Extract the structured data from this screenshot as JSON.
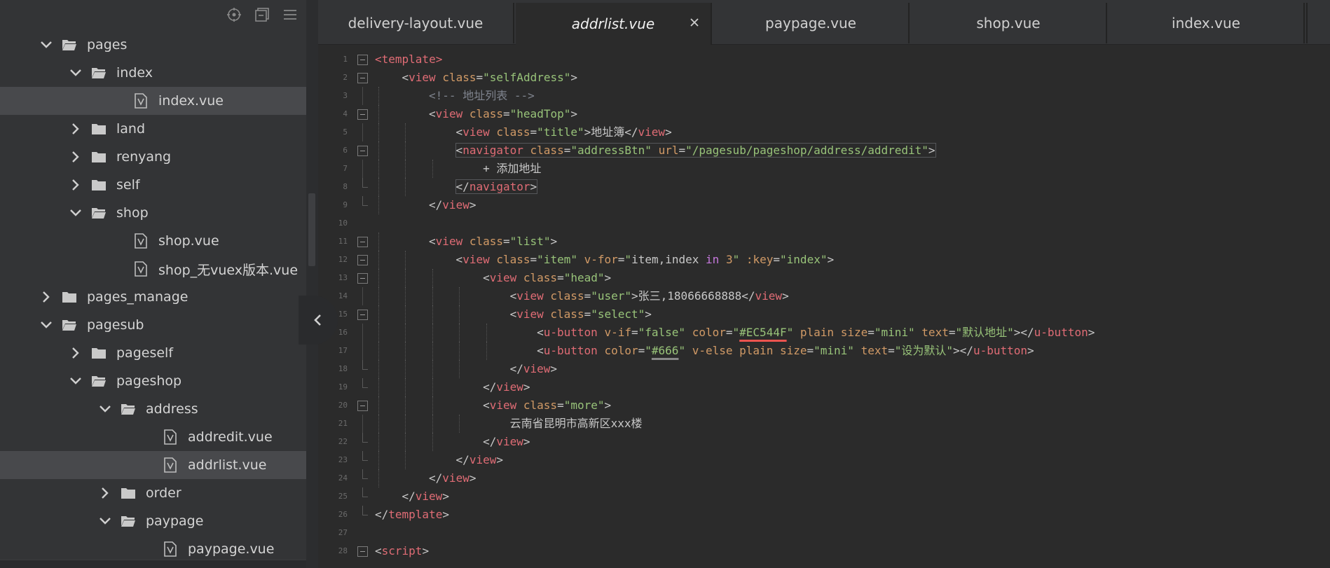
{
  "sidebar": {
    "toolbar": [
      {
        "icon": "locate-icon"
      },
      {
        "icon": "collapse-all-icon"
      },
      {
        "icon": "menu-icon"
      }
    ],
    "tree": [
      {
        "label": "pages",
        "type": "folder",
        "expanded": true,
        "depth": 1
      },
      {
        "label": "index",
        "type": "folder",
        "expanded": true,
        "depth": 2
      },
      {
        "label": "index.vue",
        "type": "file",
        "depth": 3,
        "selected": true
      },
      {
        "label": "land",
        "type": "folder",
        "expanded": false,
        "depth": 2
      },
      {
        "label": "renyang",
        "type": "folder",
        "expanded": false,
        "depth": 2
      },
      {
        "label": "self",
        "type": "folder",
        "expanded": false,
        "depth": 2
      },
      {
        "label": "shop",
        "type": "folder",
        "expanded": true,
        "depth": 2
      },
      {
        "label": "shop.vue",
        "type": "file",
        "depth": 3
      },
      {
        "label": "shop_无vuex版本.vue",
        "type": "file",
        "depth": 3
      },
      {
        "label": "pages_manage",
        "type": "folder",
        "expanded": false,
        "depth": 1
      },
      {
        "label": "pagesub",
        "type": "folder",
        "expanded": true,
        "depth": 1
      },
      {
        "label": "pageself",
        "type": "folder",
        "expanded": false,
        "depth": 2
      },
      {
        "label": "pageshop",
        "type": "folder",
        "expanded": true,
        "depth": 2
      },
      {
        "label": "address",
        "type": "folder",
        "expanded": true,
        "depth": 3
      },
      {
        "label": "addredit.vue",
        "type": "file",
        "depth": 4
      },
      {
        "label": "addrlist.vue",
        "type": "file",
        "depth": 4,
        "selected": true
      },
      {
        "label": "order",
        "type": "folder",
        "expanded": false,
        "depth": 3
      },
      {
        "label": "paypage",
        "type": "folder",
        "expanded": true,
        "depth": 3
      },
      {
        "label": "paypage.vue",
        "type": "file",
        "depth": 4
      }
    ]
  },
  "tabs": [
    {
      "label": "delivery-layout.vue",
      "active": false
    },
    {
      "label": "addrlist.vue",
      "active": true,
      "close": "×"
    },
    {
      "label": "paypage.vue",
      "active": false
    },
    {
      "label": "shop.vue",
      "active": false
    },
    {
      "label": "index.vue",
      "active": false
    }
  ],
  "editor": {
    "lines": [
      {
        "n": "1",
        "fold": "open",
        "indent": 0,
        "tokens": [
          [
            "tag",
            "<template"
          ],
          [
            "tag",
            ">"
          ]
        ]
      },
      {
        "n": "2",
        "fold": "open",
        "indent": 1,
        "tokens": [
          [
            "br",
            "<"
          ],
          [
            "tag",
            "view"
          ],
          [
            "br",
            " "
          ],
          [
            "attr",
            "class"
          ],
          [
            "br",
            "="
          ],
          [
            "str",
            "\"selfAddress\""
          ],
          [
            "br",
            ">"
          ]
        ]
      },
      {
        "n": "3",
        "fold": "",
        "indent": 2,
        "tokens": [
          [
            "cmt",
            "<!-- 地址列表 -->"
          ]
        ]
      },
      {
        "n": "4",
        "fold": "open",
        "indent": 2,
        "tokens": [
          [
            "br",
            "<"
          ],
          [
            "tag",
            "view"
          ],
          [
            "br",
            " "
          ],
          [
            "attr",
            "class"
          ],
          [
            "br",
            "="
          ],
          [
            "str",
            "\"headTop\""
          ],
          [
            "br",
            ">"
          ]
        ]
      },
      {
        "n": "5",
        "fold": "",
        "indent": 3,
        "tokens": [
          [
            "br",
            "<"
          ],
          [
            "tag",
            "view"
          ],
          [
            "br",
            " "
          ],
          [
            "attr",
            "class"
          ],
          [
            "br",
            "="
          ],
          [
            "str",
            "\"title\""
          ],
          [
            "br",
            ">"
          ],
          [
            "txt",
            "地址簿"
          ],
          [
            "br",
            "</"
          ],
          [
            "tag",
            "view"
          ],
          [
            "br",
            ">"
          ]
        ]
      },
      {
        "n": "6",
        "fold": "open",
        "indent": 3,
        "box": true,
        "tokens": [
          [
            "br",
            "<"
          ],
          [
            "tag",
            "navigator"
          ],
          [
            "br",
            " "
          ],
          [
            "attr",
            "class"
          ],
          [
            "br",
            "="
          ],
          [
            "str",
            "\"addressBtn\""
          ],
          [
            "br",
            " "
          ],
          [
            "attr",
            "url"
          ],
          [
            "br",
            "="
          ],
          [
            "str",
            "\"/pagesub/pageshop/address/addredit\""
          ],
          [
            "br",
            ">"
          ]
        ]
      },
      {
        "n": "7",
        "fold": "",
        "indent": 4,
        "tokens": [
          [
            "txt",
            "+ 添加地址"
          ]
        ]
      },
      {
        "n": "8",
        "fold": "end",
        "indent": 3,
        "box": true,
        "tokens": [
          [
            "br",
            "</"
          ],
          [
            "tag",
            "navigator"
          ],
          [
            "br",
            ">"
          ]
        ]
      },
      {
        "n": "9",
        "fold": "end",
        "indent": 2,
        "tokens": [
          [
            "br",
            "</"
          ],
          [
            "tag",
            "view"
          ],
          [
            "br",
            ">"
          ]
        ]
      },
      {
        "n": "10",
        "fold": "",
        "indent": 0,
        "tokens": []
      },
      {
        "n": "11",
        "fold": "open",
        "indent": 2,
        "tokens": [
          [
            "br",
            "<"
          ],
          [
            "tag",
            "view"
          ],
          [
            "br",
            " "
          ],
          [
            "attr",
            "class"
          ],
          [
            "br",
            "="
          ],
          [
            "str",
            "\"list\""
          ],
          [
            "br",
            ">"
          ]
        ]
      },
      {
        "n": "12",
        "fold": "open",
        "indent": 3,
        "tokens": [
          [
            "br",
            "<"
          ],
          [
            "tag",
            "view"
          ],
          [
            "br",
            " "
          ],
          [
            "attr",
            "class"
          ],
          [
            "br",
            "="
          ],
          [
            "str",
            "\"item\""
          ],
          [
            "br",
            " "
          ],
          [
            "attr",
            "v-for"
          ],
          [
            "br",
            "="
          ],
          [
            "str",
            "\""
          ],
          [
            "txt",
            "item,index "
          ],
          [
            "kw",
            "in"
          ],
          [
            "txt",
            " "
          ],
          [
            "attr",
            "3"
          ],
          [
            "str",
            "\""
          ],
          [
            "br",
            " "
          ],
          [
            "attr",
            ":key"
          ],
          [
            "br",
            "="
          ],
          [
            "str",
            "\"index\""
          ],
          [
            "br",
            ">"
          ]
        ]
      },
      {
        "n": "13",
        "fold": "open",
        "indent": 4,
        "tokens": [
          [
            "br",
            "<"
          ],
          [
            "tag",
            "view"
          ],
          [
            "br",
            " "
          ],
          [
            "attr",
            "class"
          ],
          [
            "br",
            "="
          ],
          [
            "str",
            "\"head\""
          ],
          [
            "br",
            ">"
          ]
        ]
      },
      {
        "n": "14",
        "fold": "",
        "indent": 5,
        "tokens": [
          [
            "br",
            "<"
          ],
          [
            "tag",
            "view"
          ],
          [
            "br",
            " "
          ],
          [
            "attr",
            "class"
          ],
          [
            "br",
            "="
          ],
          [
            "str",
            "\"user\""
          ],
          [
            "br",
            ">"
          ],
          [
            "txt",
            "张三,18066668888"
          ],
          [
            "br",
            "</"
          ],
          [
            "tag",
            "view"
          ],
          [
            "br",
            ">"
          ]
        ]
      },
      {
        "n": "15",
        "fold": "open",
        "indent": 5,
        "tokens": [
          [
            "br",
            "<"
          ],
          [
            "tag",
            "view"
          ],
          [
            "br",
            " "
          ],
          [
            "attr",
            "class"
          ],
          [
            "br",
            "="
          ],
          [
            "str",
            "\"select\""
          ],
          [
            "br",
            ">"
          ]
        ]
      },
      {
        "n": "16",
        "fold": "",
        "indent": 6,
        "tokens": [
          [
            "br",
            "<"
          ],
          [
            "tag",
            "u-button"
          ],
          [
            "br",
            " "
          ],
          [
            "attr",
            "v-if"
          ],
          [
            "br",
            "="
          ],
          [
            "str",
            "\"false\""
          ],
          [
            "br",
            " "
          ],
          [
            "attr",
            "color"
          ],
          [
            "br",
            "="
          ],
          [
            "str",
            "\""
          ],
          [
            "str-red",
            "#EC544F"
          ],
          [
            "str",
            "\""
          ],
          [
            "br",
            " "
          ],
          [
            "attr",
            "plain"
          ],
          [
            "br",
            " "
          ],
          [
            "attr",
            "size"
          ],
          [
            "br",
            "="
          ],
          [
            "str",
            "\"mini\""
          ],
          [
            "br",
            " "
          ],
          [
            "attr",
            "text"
          ],
          [
            "br",
            "="
          ],
          [
            "str",
            "\"默认地址\""
          ],
          [
            "br",
            "></"
          ],
          [
            "tag",
            "u-button"
          ],
          [
            "br",
            ">"
          ]
        ]
      },
      {
        "n": "17",
        "fold": "",
        "indent": 6,
        "tokens": [
          [
            "br",
            "<"
          ],
          [
            "tag",
            "u-button"
          ],
          [
            "br",
            " "
          ],
          [
            "attr",
            "color"
          ],
          [
            "br",
            "="
          ],
          [
            "str",
            "\""
          ],
          [
            "str-gray",
            "#666"
          ],
          [
            "str",
            "\""
          ],
          [
            "br",
            " "
          ],
          [
            "attr",
            "v-else"
          ],
          [
            "br",
            " "
          ],
          [
            "attr",
            "plain"
          ],
          [
            "br",
            " "
          ],
          [
            "attr",
            "size"
          ],
          [
            "br",
            "="
          ],
          [
            "str",
            "\"mini\""
          ],
          [
            "br",
            " "
          ],
          [
            "attr",
            "text"
          ],
          [
            "br",
            "="
          ],
          [
            "str",
            "\"设为默认\""
          ],
          [
            "br",
            "></"
          ],
          [
            "tag",
            "u-button"
          ],
          [
            "br",
            ">"
          ]
        ]
      },
      {
        "n": "18",
        "fold": "end",
        "indent": 5,
        "tokens": [
          [
            "br",
            "</"
          ],
          [
            "tag",
            "view"
          ],
          [
            "br",
            ">"
          ]
        ]
      },
      {
        "n": "19",
        "fold": "end",
        "indent": 4,
        "tokens": [
          [
            "br",
            "</"
          ],
          [
            "tag",
            "view"
          ],
          [
            "br",
            ">"
          ]
        ]
      },
      {
        "n": "20",
        "fold": "open",
        "indent": 4,
        "tokens": [
          [
            "br",
            "<"
          ],
          [
            "tag",
            "view"
          ],
          [
            "br",
            " "
          ],
          [
            "attr",
            "class"
          ],
          [
            "br",
            "="
          ],
          [
            "str",
            "\"more\""
          ],
          [
            "br",
            ">"
          ]
        ]
      },
      {
        "n": "21",
        "fold": "",
        "indent": 5,
        "tokens": [
          [
            "txt",
            "云南省昆明市高新区xxx楼"
          ]
        ]
      },
      {
        "n": "22",
        "fold": "end",
        "indent": 4,
        "tokens": [
          [
            "br",
            "</"
          ],
          [
            "tag",
            "view"
          ],
          [
            "br",
            ">"
          ]
        ]
      },
      {
        "n": "23",
        "fold": "end",
        "indent": 3,
        "tokens": [
          [
            "br",
            "</"
          ],
          [
            "tag",
            "view"
          ],
          [
            "br",
            ">"
          ]
        ]
      },
      {
        "n": "24",
        "fold": "end",
        "indent": 2,
        "tokens": [
          [
            "br",
            "</"
          ],
          [
            "tag",
            "view"
          ],
          [
            "br",
            ">"
          ]
        ]
      },
      {
        "n": "25",
        "fold": "end",
        "indent": 1,
        "tokens": [
          [
            "br",
            "</"
          ],
          [
            "tag",
            "view"
          ],
          [
            "br",
            ">"
          ]
        ]
      },
      {
        "n": "26",
        "fold": "end",
        "indent": 0,
        "tokens": [
          [
            "br",
            "</"
          ],
          [
            "tag",
            "template"
          ],
          [
            "br",
            ">"
          ]
        ]
      },
      {
        "n": "27",
        "fold": "",
        "indent": 0,
        "tokens": []
      },
      {
        "n": "28",
        "fold": "open",
        "indent": 0,
        "tokens": [
          [
            "br",
            "<"
          ],
          [
            "tag",
            "script"
          ],
          [
            "br",
            ">"
          ]
        ]
      }
    ]
  }
}
